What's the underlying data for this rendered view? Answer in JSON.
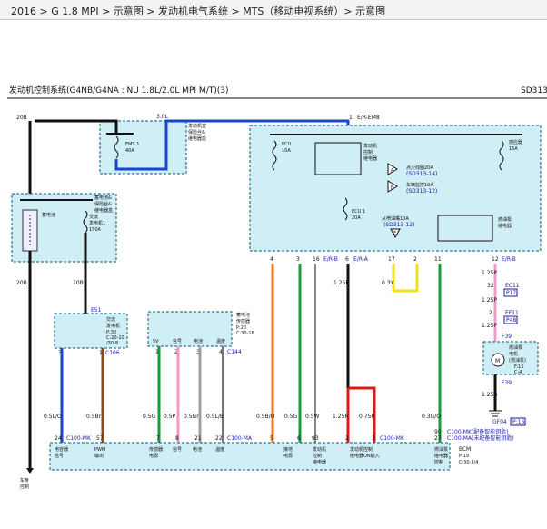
{
  "breadcrumb": "2016 > G 1.8 MPI > 示意图 > 发动机电气系统 > MTS（移动电视系统）> 示意图",
  "diagram": {
    "title": "发动机控制系统(G4NB/G4NA : NU 1.8L/2.0L MPI M/T)(3)",
    "code": "SD313",
    "colors": {
      "box_fill": "#cfeef5",
      "box_stroke": "#0a5a80",
      "blue_wire": "#1846c8",
      "orange_wire": "#f07a10",
      "green_wire": "#1a9a3a",
      "pink_wire": "#f09ac8",
      "gray_wire": "#a0a0a0",
      "red_wire": "#e01818",
      "yellow_wire": "#f0e01a",
      "brown_wire": "#8a4a20",
      "black_wire": "#111111"
    },
    "top_left": {
      "wire_size_left": "20B",
      "wire_size_mid": "3.0L",
      "ems1_label": "EMS 1",
      "ems1_rating": "40A",
      "box_text": [
        "发动机室",
        "保险丝&",
        "继电器盒"
      ]
    },
    "battery_box": {
      "text": [
        "蓄电池&",
        "保险丝&",
        "继电器盒"
      ],
      "battery_label": "蓄电池",
      "alt_fuse_label": "交流",
      "alt_fuse_label2": "发电机1",
      "alt_fuse_rating": "150A",
      "wire_left": "20B",
      "wire_right": "20B"
    },
    "right_box": {
      "pin_top": "1",
      "wire_top": "E/R-EM8",
      "ecu_fuse": "ECU",
      "ecu_fuse_rating": "10A",
      "main_relay": [
        "发动机",
        "控制",
        "继电器"
      ],
      "sensor_fuse": "感应器",
      "sensor_fuse_rating": "15A",
      "fuse_a_label": "点火线圈20A",
      "fuse_a_ref": "(SD313-14)",
      "fuse_b_label": "车辆监控10A",
      "fuse_b_ref": "(SD313-12)",
      "ecu1_fuse": "ECU 1",
      "ecu1_rating": "20A",
      "fuel_fuse_label": "从喷油嘴10A",
      "fuel_fuse_ref": "(SD313-12)",
      "fuel_relay": [
        "燃油泵",
        "继电器"
      ],
      "letter_a": "A",
      "letter_b": "B",
      "letter_e": "E",
      "pins": [
        "4",
        "3",
        "16",
        "E/R-B",
        "6",
        "E/R-A",
        "17",
        "2",
        "11",
        "12",
        "E/R-B"
      ]
    },
    "right_wires": {
      "w1": "1.25R",
      "w2": "0.3Y",
      "w3": "1.25P"
    },
    "fuel_side": {
      "pin32": "32",
      "ec11": "EC11",
      "ref1": "P17",
      "pin2": "2",
      "ef11": "EF11",
      "ref2": "P48",
      "w_between": "1.25P",
      "w_between2": "1.25P",
      "f39": "F39",
      "motor_text": [
        "燃油泵",
        "电机",
        "(燃油泵)"
      ],
      "motor_ref": "F:15",
      "motor_ref2": "C:4",
      "f39_pin": "F39",
      "ground_wire": "1.25B",
      "gf": "GF04",
      "gf_ref": "P:16"
    },
    "alternator": {
      "connector": "E51",
      "pin_left": "3",
      "pin_right": "1",
      "conn": "C106",
      "text": [
        "交流",
        "发电机"
      ],
      "refs": [
        "P:30",
        "C:20-10",
        "/30-8"
      ]
    },
    "battery_sensor": {
      "text": [
        "蓄电池",
        "传感器"
      ],
      "refs": [
        "P:20",
        "C:30-16"
      ],
      "labels": [
        "5V",
        "信号",
        "电池",
        "温度"
      ],
      "pins": [
        "1",
        "2",
        "3",
        "4"
      ],
      "conn": "C144"
    },
    "mid_wires": [
      "0.5L/O",
      "0.5Br",
      "0.5G",
      "0.5P",
      "0.5Gr",
      "0.5L/B",
      "0.5B/O",
      "0.5G",
      "0.5W",
      "1.25R",
      "0.75R",
      "0.3G/O"
    ],
    "ecm_pins": [
      "24",
      "C100-MK",
      "57",
      "7",
      "8",
      "21",
      "22",
      "C100-MA",
      "5",
      "6",
      "93",
      "2",
      "3",
      "C100-MK",
      "90",
      "27"
    ],
    "ecm_labels": [
      "电容器",
      "信号",
      "PWM",
      "输出",
      "传感器",
      "电源",
      "信号",
      "电池",
      "温度",
      "接地",
      "电源",
      "发动机",
      "控制",
      "继电器",
      "发动机控制",
      "继电器ON输入",
      "燃油泵",
      "继电器",
      "控制"
    ],
    "ecm_right_notes": [
      "C100-MK(配备智能钥匙)",
      "C100-MA(未配备智能钥匙)"
    ],
    "ecm_name": "ECM",
    "ecm_refs": [
      "P:19",
      "C:30-3/4"
    ],
    "left_bottom": [
      "车身",
      "控制"
    ]
  }
}
